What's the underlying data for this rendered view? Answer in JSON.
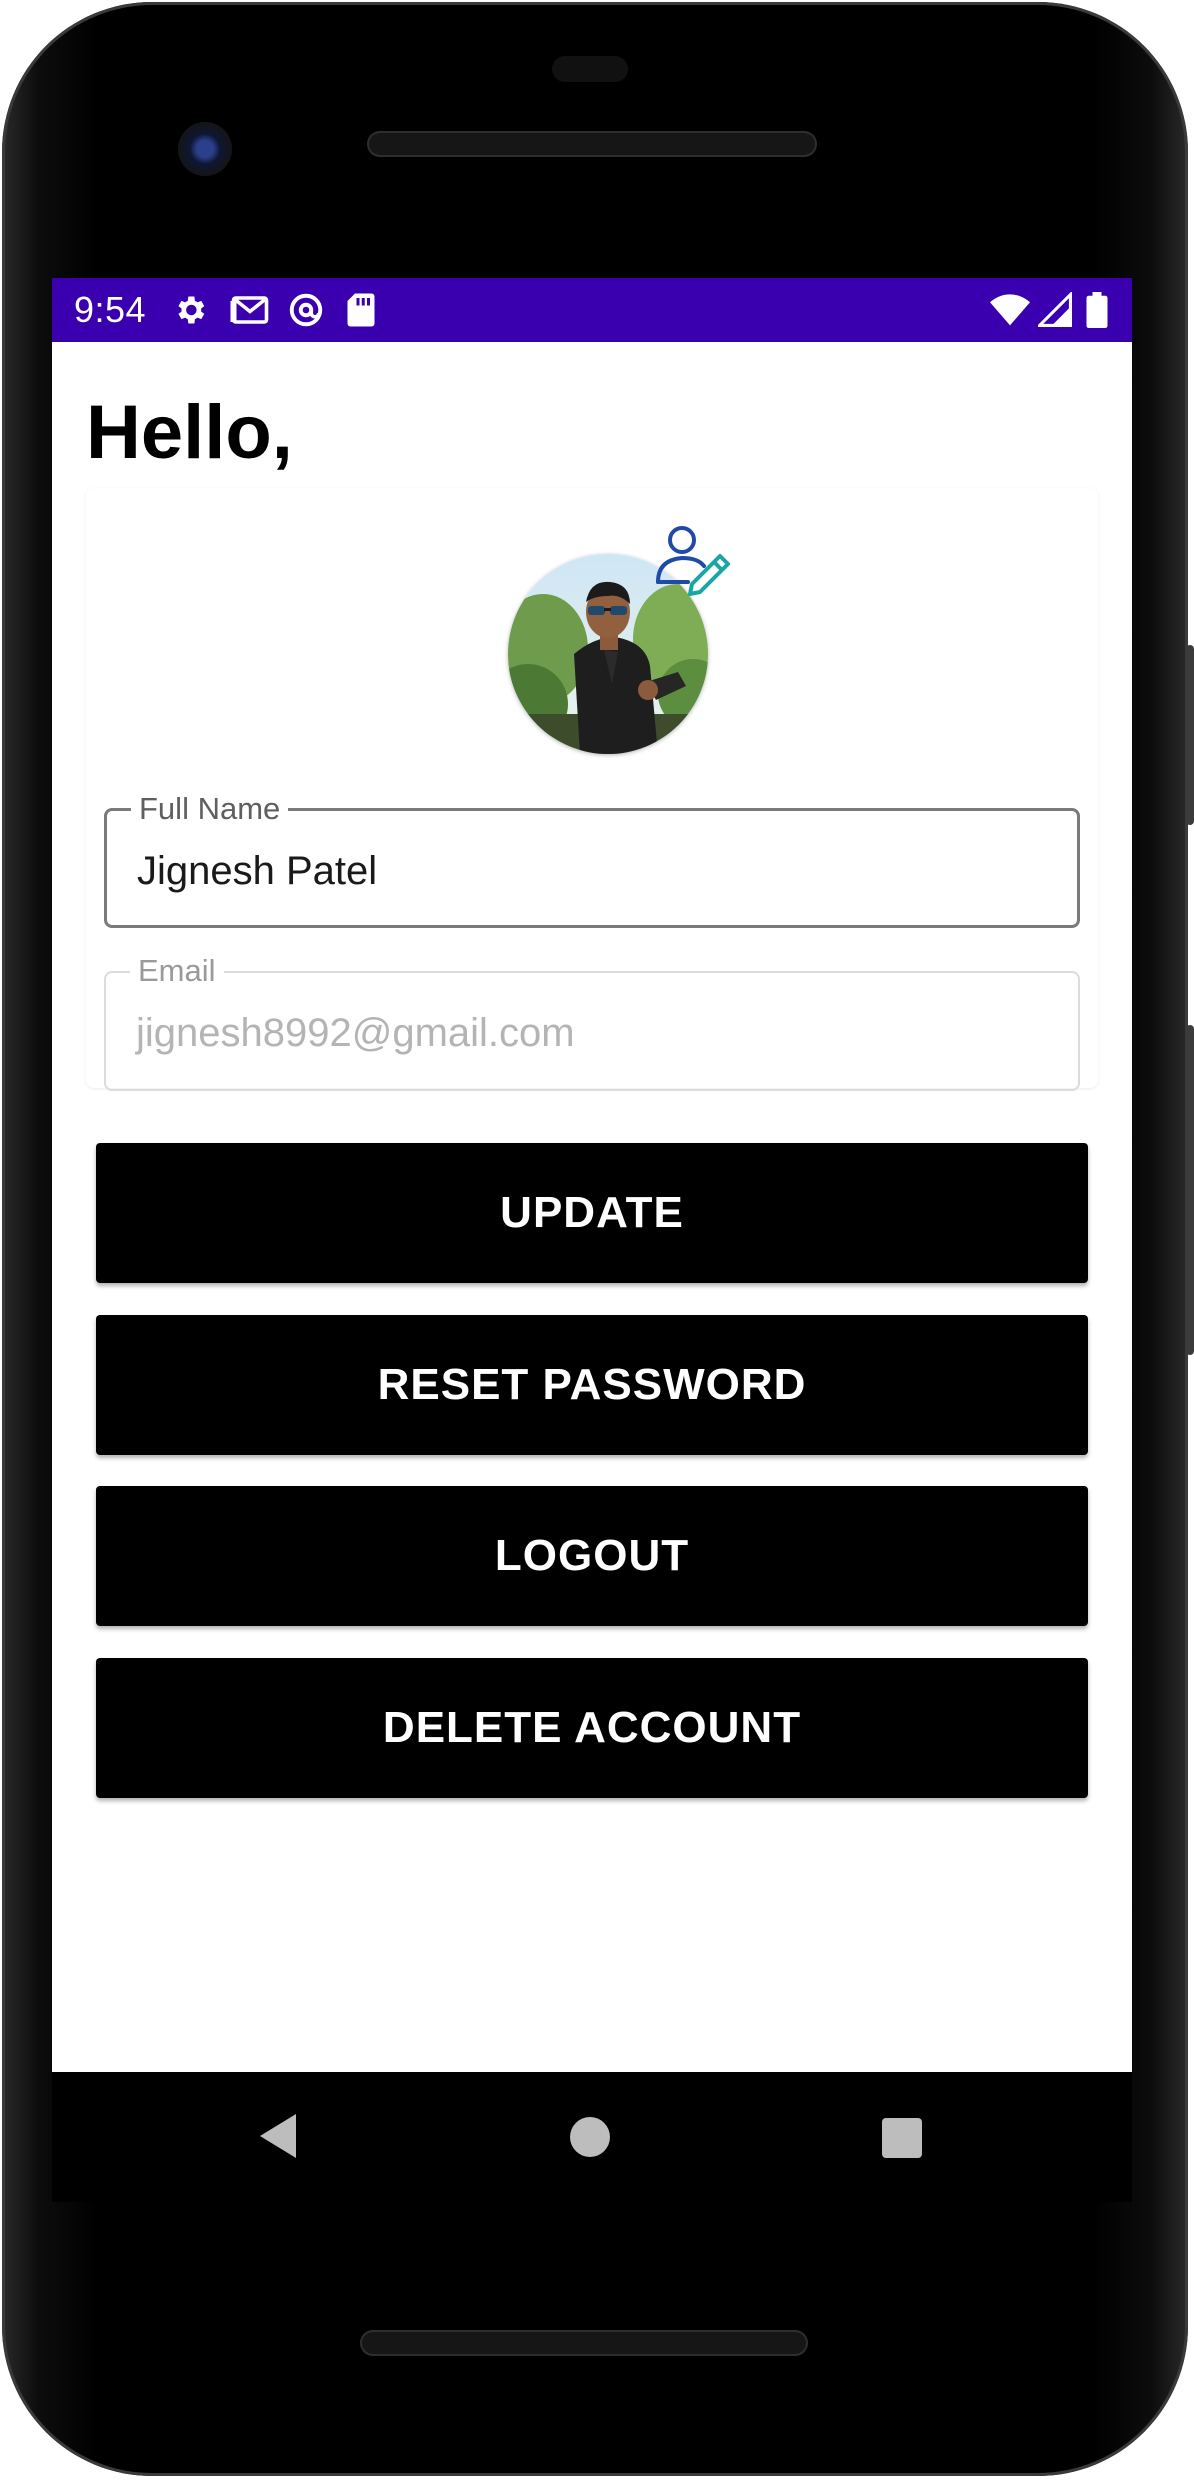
{
  "status_bar": {
    "time": "9:54",
    "left_icons": [
      "gear-icon",
      "gmail-icon",
      "at-sign-icon",
      "sd-card-icon"
    ],
    "right_icons": [
      "wifi-icon",
      "cell-signal-icon",
      "battery-icon"
    ],
    "color": "#3a00b0"
  },
  "header": {
    "greeting": "Hello,"
  },
  "profile": {
    "avatar": "profile-photo",
    "edit_icon": "edit-user-icon"
  },
  "form": {
    "full_name": {
      "label": "Full Name",
      "value": "Jignesh Patel"
    },
    "email": {
      "label": "Email",
      "value": "jignesh8992@gmail.com"
    }
  },
  "actions": {
    "update": "UPDATE",
    "reset_password": "RESET PASSWORD",
    "logout": "LOGOUT",
    "delete_account": "DELETE ACCOUNT"
  },
  "nav_bar": {
    "buttons": [
      "back-icon",
      "home-icon",
      "recents-icon"
    ]
  }
}
